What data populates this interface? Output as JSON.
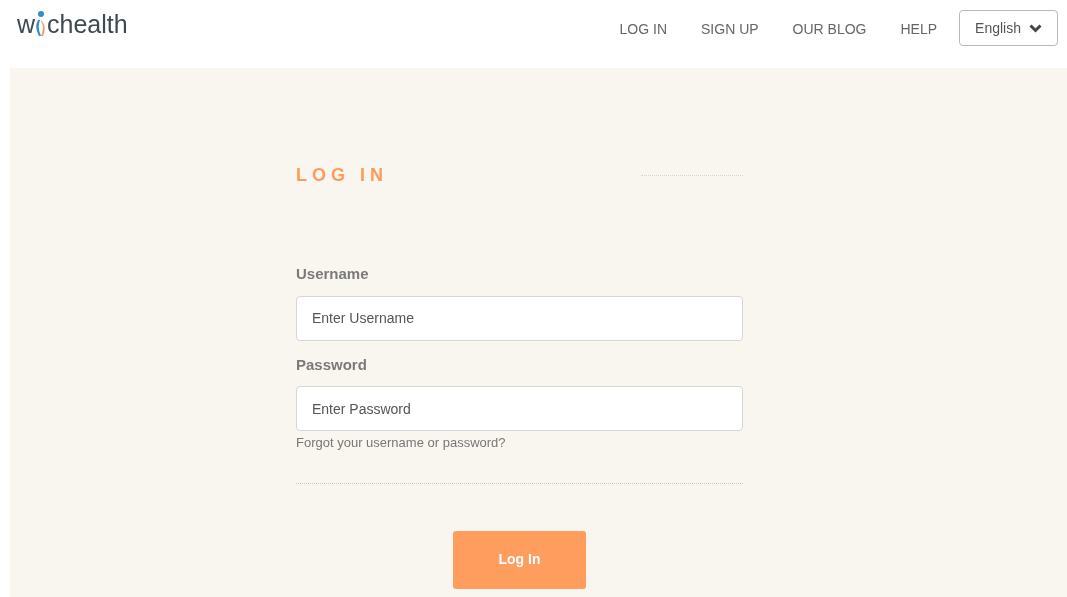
{
  "logo": {
    "before": "w",
    "after": "chealth"
  },
  "nav": [
    "LOG IN",
    "SIGN UP",
    "OUR BLOG",
    "HELP"
  ],
  "language": {
    "label": "English"
  },
  "form": {
    "title": "LOG IN",
    "fields": [
      {
        "label": "Username",
        "placeholder": "Enter Username"
      },
      {
        "label": "Password",
        "placeholder": "Enter Password"
      }
    ],
    "forgot_link": "Forgot your username or password?",
    "submit": "Log In"
  }
}
